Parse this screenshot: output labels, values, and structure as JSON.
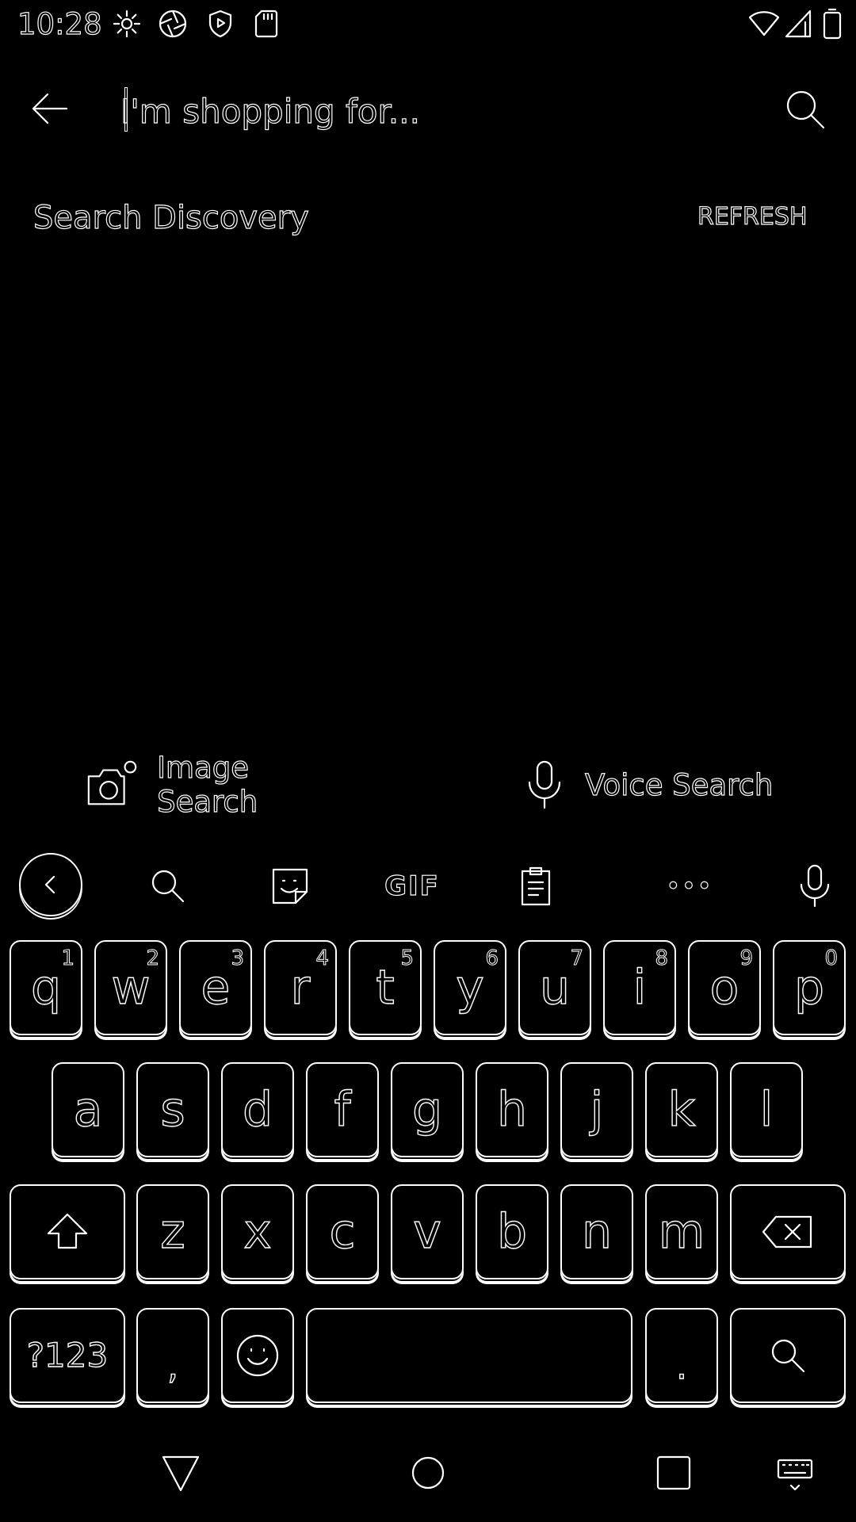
{
  "status_bar": {
    "time": "10:28",
    "left_icons": [
      "gear-icon",
      "camera-shutter-icon",
      "shield-play-icon",
      "sd-card-icon"
    ],
    "right_icons": [
      "wifi-icon",
      "signal-icon",
      "battery-icon"
    ]
  },
  "header": {
    "search_placeholder": "I'm shopping for...",
    "back_icon": "arrow-left-icon",
    "search_icon": "search-icon"
  },
  "discovery": {
    "title": "Search Discovery",
    "refresh_label": "REFRESH"
  },
  "features": {
    "image_search_label": "Image Search",
    "voice_search_label": "Voice Search"
  },
  "keyboard": {
    "toolbar": {
      "gif_label": "GIF",
      "more_label": "•••",
      "icons": [
        "chevron-left-icon",
        "search-icon",
        "sticker-icon",
        "gif-icon",
        "clipboard-icon",
        "more-icon",
        "microphone-icon"
      ]
    },
    "row1": [
      {
        "letter": "q",
        "hint": "1"
      },
      {
        "letter": "w",
        "hint": "2"
      },
      {
        "letter": "e",
        "hint": "3"
      },
      {
        "letter": "r",
        "hint": "4"
      },
      {
        "letter": "t",
        "hint": "5"
      },
      {
        "letter": "y",
        "hint": "6"
      },
      {
        "letter": "u",
        "hint": "7"
      },
      {
        "letter": "i",
        "hint": "8"
      },
      {
        "letter": "o",
        "hint": "9"
      },
      {
        "letter": "p",
        "hint": "0"
      }
    ],
    "row2": [
      "a",
      "s",
      "d",
      "f",
      "g",
      "h",
      "j",
      "k",
      "l"
    ],
    "row3": [
      "z",
      "x",
      "c",
      "v",
      "b",
      "n",
      "m"
    ],
    "symbols_label": "?123",
    "comma": ",",
    "period": "."
  },
  "nav_bar": {
    "icons": [
      "back-triangle-icon",
      "home-circle-icon",
      "recents-square-icon",
      "keyboard-icon"
    ]
  }
}
